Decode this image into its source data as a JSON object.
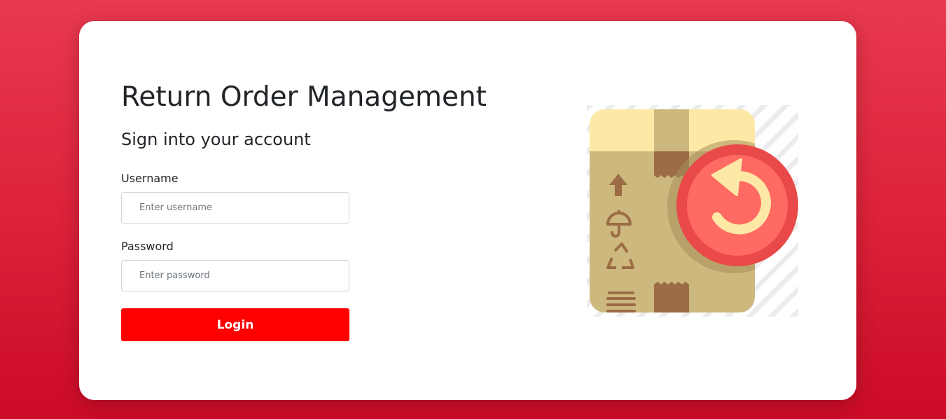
{
  "app": {
    "title": "Return Order Management",
    "subtitle": "Sign into your account"
  },
  "form": {
    "username_label": "Username",
    "username_placeholder": "Enter username",
    "username_value": "",
    "password_label": "Password",
    "password_placeholder": "Enter password",
    "password_value": "",
    "login_label": "Login"
  },
  "illustration": {
    "icon": "return-package-icon"
  },
  "colors": {
    "background_top": "#e8394f",
    "background_bottom": "#cc0b27",
    "login_button": "#ff0000",
    "box": "#cdb87e",
    "box_lid": "#fde9a5",
    "tape": "#9b6c45",
    "return_badge": "#f25a57",
    "return_arrow": "#fde9a5"
  }
}
